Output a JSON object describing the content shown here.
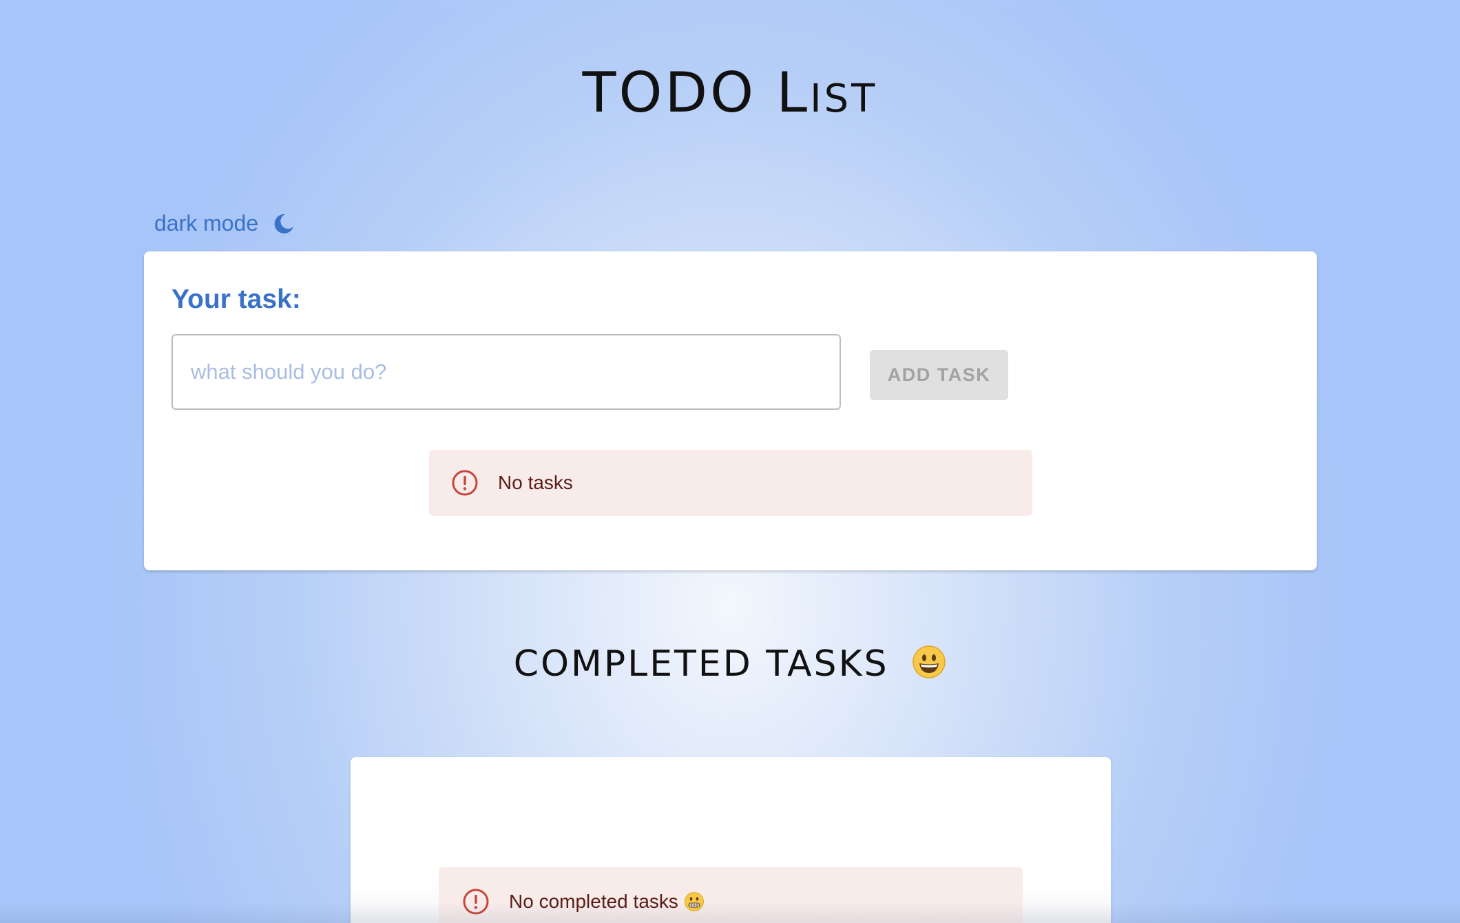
{
  "header": {
    "title": "TODO List"
  },
  "theme_toggle": {
    "label": "dark mode",
    "icon": "moon-icon"
  },
  "task_form": {
    "label": "Your task:",
    "input_value": "",
    "input_placeholder": "what should you do?",
    "add_button_label": "ADD TASK"
  },
  "tasks_alert": {
    "message": "No tasks",
    "icon": "alert-circle-icon"
  },
  "completed": {
    "title": "COMPLETED TASKS",
    "title_icon": "grinning-face-icon",
    "alert_message": "No completed tasks",
    "alert_emoji_icon": "grimacing-face-icon"
  },
  "colors": {
    "accent": "#3a72c8",
    "alert_bg": "#f8ecea",
    "alert_text": "#5a1c17",
    "alert_icon": "#c8453c",
    "disabled_button_bg": "#e0e0e0",
    "background": "#a7c5f8"
  }
}
